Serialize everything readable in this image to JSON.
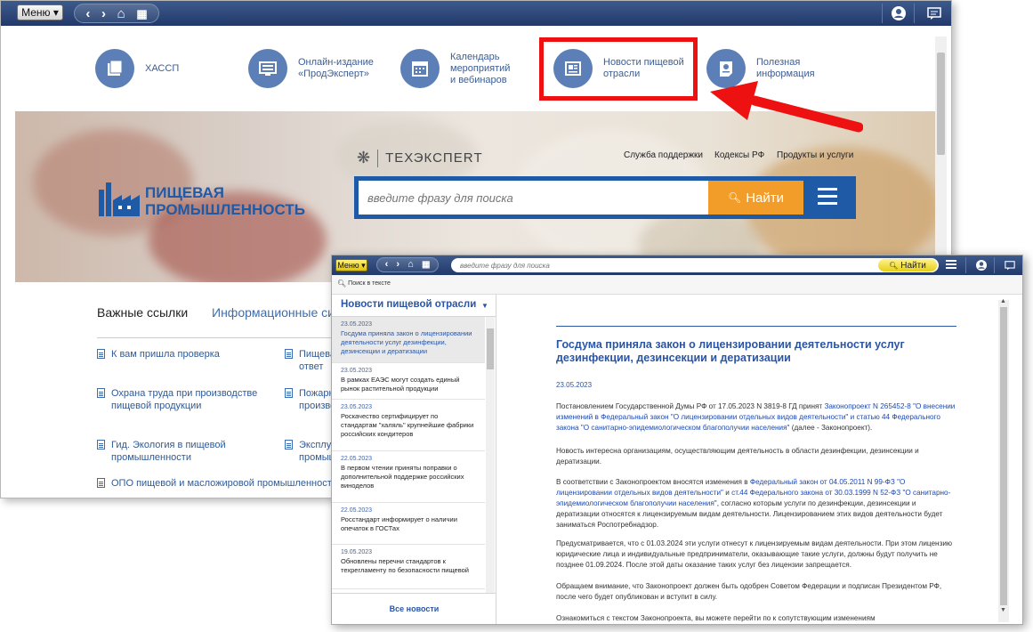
{
  "main_window": {
    "menu_label": "Меню ▾",
    "top_icons": [
      {
        "label": "ХАССП",
        "icon": "folders-icon"
      },
      {
        "label": "Онлайн-издание\n«ПродЭксперт»",
        "icon": "monitor-icon"
      },
      {
        "label": "Календарь\nмероприятий\nи вебинаров",
        "icon": "calendar-icon"
      },
      {
        "label": "Новости пищевой\nотрасли",
        "icon": "newspaper-icon"
      },
      {
        "label": "Полезная\nинформация",
        "icon": "info-icon"
      }
    ],
    "brand_name": "ТЕХЭКСПЕRТ",
    "product_title_line1": "ПИЩЕВАЯ",
    "product_title_line2": "ПРОМЫШЛЕННОСТЬ",
    "header_links": [
      "Служба поддержки",
      "Кодексы РФ",
      "Продукты и услуги"
    ],
    "search": {
      "placeholder": "введите фразу для поиска",
      "button": "Найти"
    },
    "tabs": [
      "Важные ссылки",
      "Информационные сис"
    ],
    "links_col1": [
      "К вам пришла проверка",
      "Охрана труда при производстве\nпищевой продукции",
      "Гид. Экология в пищевой\nпромышленности",
      "ОПО пищевой и масложировой промышленности"
    ],
    "links_col2": [
      "Пищева\nответ",
      "Пожарн\nпроизвод",
      "Эксплуат\nпромышл"
    ]
  },
  "news_window": {
    "menu_label": "Меню ▾",
    "search_placeholder": "введите фразу для поиска",
    "find_button": "Найти",
    "search_in_text": "Поиск в тексте",
    "sidebar_title": "Новости пищевой отрасли",
    "news": [
      {
        "date": "23.05.2023",
        "text": "Госдума приняла закон о лицензировании деятельности услуг дезинфекции, дезинсекции и дератизации"
      },
      {
        "date": "23.05.2023",
        "text": "В рамках ЕАЭС могут создать единый рынок растительной продукции"
      },
      {
        "date": "23.05.2023",
        "text": "Роскачество сертифицирует по стандартам \"халяль\" крупнейшие фабрики российских кондитеров"
      },
      {
        "date": "22.05.2023",
        "text": "В первом чтении приняты поправки о дополнительной поддержке российских виноделов"
      },
      {
        "date": "22.05.2023",
        "text": "Росстандарт информирует о наличии опечаток в ГОСТах"
      },
      {
        "date": "19.05.2023",
        "text": "Обновлены перечни стандартов к техрегламенту по безопасности пищевой"
      }
    ],
    "all_news": "Все новости",
    "article": {
      "title": "Госдума приняла закон о лицензировании деятельности услуг дезинфекции, дезинсекции и дератизации",
      "date": "23.05.2023",
      "p1_a": "Постановлением Государственной Думы РФ от 17.05.2023 N 3819-8 ГД принят ",
      "p1_link": "Законопроект N 265452-8 \"О внесении изменений в Федеральный закон \"О лицензировании отдельных видов деятельности\" и статью 44 Федерального закона \"О санитарно-эпидемиологическом благополучии населения\"",
      "p1_b": " (далее - Законопроект).",
      "p2": "Новость интересна организациям, осуществляющим деятельность в области дезинфекции, дезинсекции и дератизации.",
      "p3_a": "В соответствии с Законопроектом вносятся изменения в ",
      "p3_link1": "Федеральный закон от 04.05.2011 N 99-ФЗ \"О лицензировании отдельных видов деятельности\"",
      "p3_b": " и ",
      "p3_link2": "ст.44 Федерального закона от 30.03.1999 N 52-ФЗ \"О санитарно-эпидемиологическом благополучии населения\"",
      "p3_c": ", согласно которым услуги по дезинфекции, дезинсекции и дератизации относятся к лицензируемым видам деятельности. Лицензированием этих видов деятельности будет заниматься Роспотребнадзор.",
      "p4": "Предусматривается, что с 01.03.2024 эти услуги отнесут к лицензируемым видам деятельности. При этом лицензию юридические лица и индивидуальные предприниматели, оказывающие такие услуги, должны будут получить не позднее 01.09.2024. После этой даты оказание таких услуг без лицензии запрещается.",
      "p5": "Обращаем внимание, что Законопроект должен быть одобрен Советом Федерации и подписан Президентом РФ, после чего будет опубликован и вступит в силу.",
      "p6": "Ознакомиться с текстом Законопроекта, вы можете перейти по к сопутствующим изменениям"
    }
  },
  "colors": {
    "accent": "#3b5b8f",
    "highlight": "#ee1111",
    "find_button": "#f29c29",
    "link": "#1c49b0"
  }
}
